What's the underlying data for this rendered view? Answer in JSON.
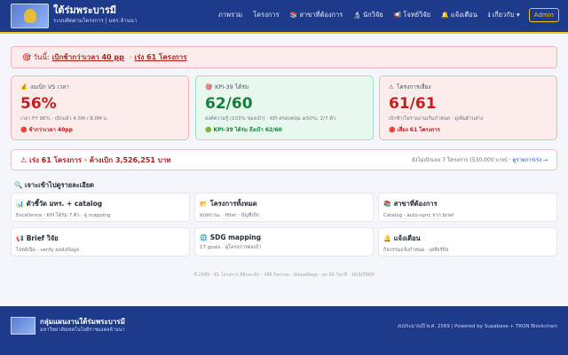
{
  "header": {
    "title": "ใต้ร่มพระบารมี",
    "subtitle": "ระบบติดตามโครงการ | มทร.ล้านนา",
    "nav": [
      {
        "icon": "",
        "label": "ภาพรวม"
      },
      {
        "icon": "",
        "label": "โครงการ"
      },
      {
        "icon": "📚",
        "label": "สาขาที่ต้องการ"
      },
      {
        "icon": "🔬",
        "label": "นักวิจัย"
      },
      {
        "icon": "📢",
        "label": "โจทย์วิจัย"
      },
      {
        "icon": "🔔",
        "label": "แจ้งเตือน"
      },
      {
        "icon": "ℹ",
        "label": "เกี่ยวกับ ▾"
      }
    ],
    "admin_label": "Admin"
  },
  "alert": {
    "today": "🎯 วันนี้:",
    "task1": "เบิกช้ากว่าเวลา 40 pp",
    "task2": "เร่ง 61 โครงการ"
  },
  "cards": [
    {
      "icon": "💰",
      "title": "งบเบิก VS เวลา",
      "value": "56%",
      "sub": "เวลา FY 96% · เบิกแล้ว 4.5M / 8.0M บ.",
      "foot": "🔴 ช้ากว่าเวลา 40pp",
      "tone": "red"
    },
    {
      "icon": "🎯",
      "title": "KPI-39 ได้ร่ม",
      "value": "62/60",
      "sub": "องค์ความรู้ (103% ของเป้า) · KPI ครอบคลุม ≥50%: 2/7 ตัว",
      "foot": "🟢 KPI-39 ได้ร่ม ถึงเป้า 62/60",
      "tone": "green"
    },
    {
      "icon": "⚠",
      "title": "โครงการเสี่ยง",
      "value": "61/61",
      "sub": "เบิกช้า/ไม่รายงานเกินกำหนด · ดูเพิ่มด้านล่าง",
      "foot": "🔴 เสี่ยง 61 โครงการ",
      "tone": "red"
    }
  ],
  "summary": {
    "left": "⚠ เร่ง 61 โครงการ · ค้างเบิก 3,526,251 บาท",
    "right": "ยังไม่เบิกเลย 7 โครงการ (530,000 บาท) ·",
    "link": "ดูรายการเร่ง →"
  },
  "section_heading": "🔍 เจาะเข้าไปดูรายละเอียด",
  "tiles": [
    {
      "icon": "📊",
      "title": "ตัวชี้วัด มทร. + catalog",
      "sub": "Excellence · KPI ได้ร่ม 7 ตัว · ดู mapping"
    },
    {
      "icon": "📂",
      "title": "โครงการทั้งหมด",
      "sub": "ทุกสถานะ · filter · บัญชีเบิก"
    },
    {
      "icon": "📚",
      "title": "สาขาที่ต้องการ",
      "sub": "Catalog · auto-sync จาก brief"
    },
    {
      "icon": "📢",
      "title": "Brief วิจัย",
      "sub": "โจทย์เปิด · verify ผลส่งข้อมูล"
    },
    {
      "icon": "🌐",
      "title": "SDG mapping",
      "sub": "17 goals · ดูโครงการต่อเป้า"
    },
    {
      "icon": "🔔",
      "title": "แจ้งเตือน",
      "sub": "กิจกรรมแจ้งกำหนด · เคลียร์บิล"
    }
  ],
  "update_note": "ปี 2569 · 61 โครงการ ที่ยังจะเบิก · 266 กิจกรรม · อัปเดตข้อมูล · ทุก 60 วินาที · 16/9/2569",
  "footer": {
    "title": "กลุ่มแผนงานใต้ร่มพระบารมี",
    "subtitle": "มหาวิทยาลัยเทคโนโลยีราชมงคลล้านนา",
    "right": "งบประมาณปี พ.ศ. 2569 | Powered by Supabase + TRON Blockchain"
  },
  "colors": {
    "navy": "#1e3a8a",
    "gold": "#f5c518",
    "danger": "#c81e1e",
    "success": "#15803d"
  }
}
